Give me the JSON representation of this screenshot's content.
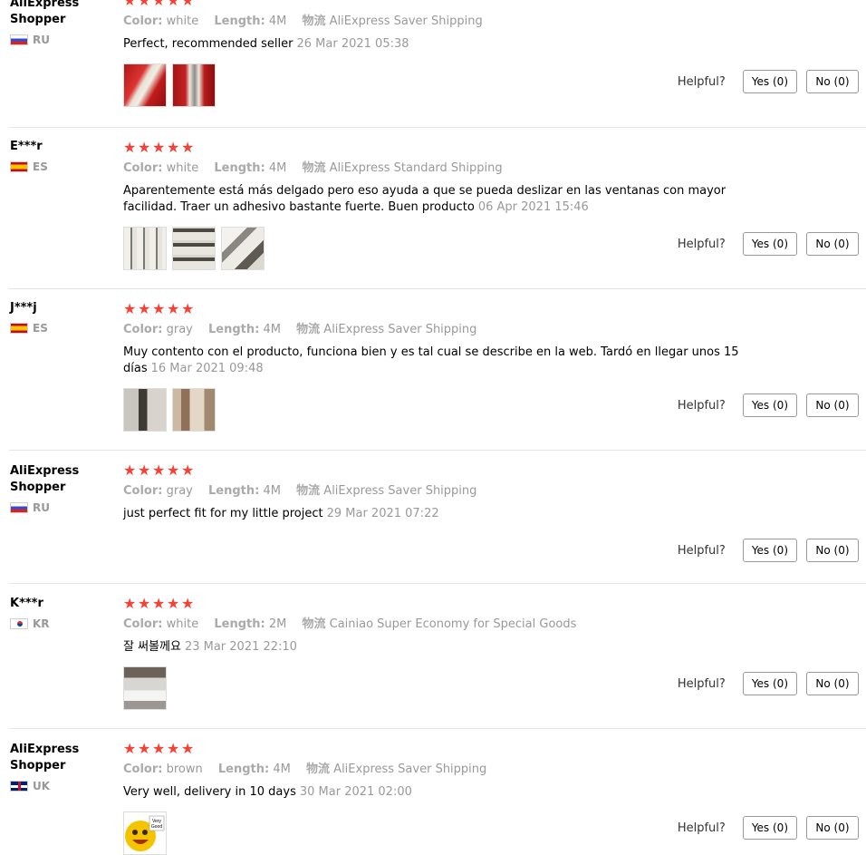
{
  "labels": {
    "color": "Color:",
    "length": "Length:",
    "shipping": "物流",
    "helpful": "Helpful?"
  },
  "reviews": [
    {
      "user": "AliExpress Shopper",
      "country": "RU",
      "color": "white",
      "length": "4M",
      "shipping": "AliExpress Saver Shipping",
      "text": "Perfect, recommended seller",
      "date": "26 Mar 2021 05:38",
      "photos": [
        "photo-tape-roll-red",
        "photo-tape-roll-red-2"
      ],
      "yes": "Yes (0)",
      "no": "No (0)"
    },
    {
      "user": "E***r",
      "country": "ES",
      "color": "white",
      "length": "4M",
      "shipping": "AliExpress Standard Shipping",
      "text": "Aparentemente está más delgado pero eso ayuda a que se pueda deslizar en las ventanas con mayor facilidad. Traer un adhesivo bastante fuerte. Buen producto",
      "date": "06 Apr 2021 15:46",
      "photos": [
        "photo-strips-1",
        "photo-strips-2",
        "photo-strips-3"
      ],
      "yes": "Yes (0)",
      "no": "No (0)"
    },
    {
      "user": "J***j",
      "country": "ES",
      "color": "gray",
      "length": "4M",
      "shipping": "AliExpress Saver Shipping",
      "text": "Muy contento con el producto, funciona bien y es tal cual se describe en la web. Tardó en llegar unos 15 días",
      "date": "16 Mar 2021 09:48",
      "photos": [
        "photo-window-frame-1",
        "photo-window-frame-2"
      ],
      "yes": "Yes (0)",
      "no": "No (0)"
    },
    {
      "user": "AliExpress Shopper",
      "country": "RU",
      "color": "gray",
      "length": "4M",
      "shipping": "AliExpress Saver Shipping",
      "text": "just perfect fit for my little project",
      "date": "29 Mar 2021 07:22",
      "photos": [],
      "yes": "Yes (0)",
      "no": "No (0)"
    },
    {
      "user": "K***r",
      "country": "KR",
      "color": "white",
      "length": "2M",
      "shipping": "Cainiao Super Economy for Special Goods",
      "text": "잘 써볼께요",
      "date": "23 Mar 2021 22:10",
      "photos": [
        "photo-installed-strip"
      ],
      "yes": "Yes (0)",
      "no": "No (0)"
    },
    {
      "user": "AliExpress Shopper",
      "country": "UK",
      "color": "brown",
      "length": "4M",
      "shipping": "AliExpress Saver Shipping",
      "text": "Very well, delivery in 10 days",
      "date": "30 Mar 2021 02:00",
      "photos": [
        "photo-very-good-emoji"
      ],
      "yes": "Yes (0)",
      "no": "No (0)"
    }
  ],
  "colors": {
    "star": "#f44336",
    "muted": "#999999",
    "divider": "#e5e5e5"
  }
}
